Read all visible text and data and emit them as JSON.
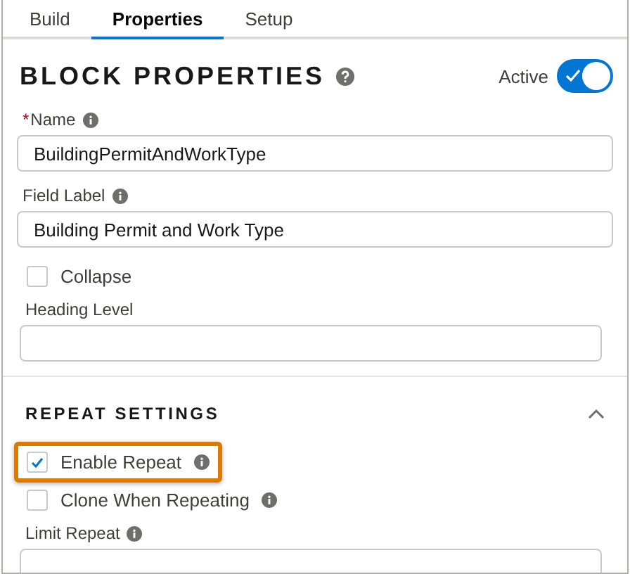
{
  "tabs": [
    {
      "label": "Build",
      "selected": false
    },
    {
      "label": "Properties",
      "selected": true
    },
    {
      "label": "Setup",
      "selected": false
    }
  ],
  "sections": [
    {
      "title": "BLOCK PROPERTIES",
      "help": true,
      "active": {
        "label": "Active",
        "on": true
      },
      "items": [
        {
          "kind": "text",
          "required_mark": "*",
          "label": "Name",
          "info": true,
          "value": "BuildingPermitAndWorkType"
        },
        {
          "kind": "text",
          "label": "Field Label",
          "info": true,
          "value": "Building Permit and Work Type"
        },
        {
          "kind": "checkbox",
          "label": "Collapse",
          "checked": false,
          "info": false,
          "highlighted": false
        },
        {
          "kind": "text",
          "label": "Heading Level",
          "info": false,
          "value": ""
        }
      ]
    },
    {
      "title": "REPEAT SETTINGS",
      "help": false,
      "expanded": true,
      "items": [
        {
          "kind": "checkbox",
          "label": "Enable Repeat",
          "checked": true,
          "info": true,
          "highlighted": true
        },
        {
          "kind": "checkbox",
          "label": "Clone When Repeating",
          "checked": false,
          "info": true,
          "highlighted": false
        },
        {
          "kind": "text",
          "label": "Limit Repeat",
          "info": true,
          "value": ""
        }
      ]
    }
  ]
}
